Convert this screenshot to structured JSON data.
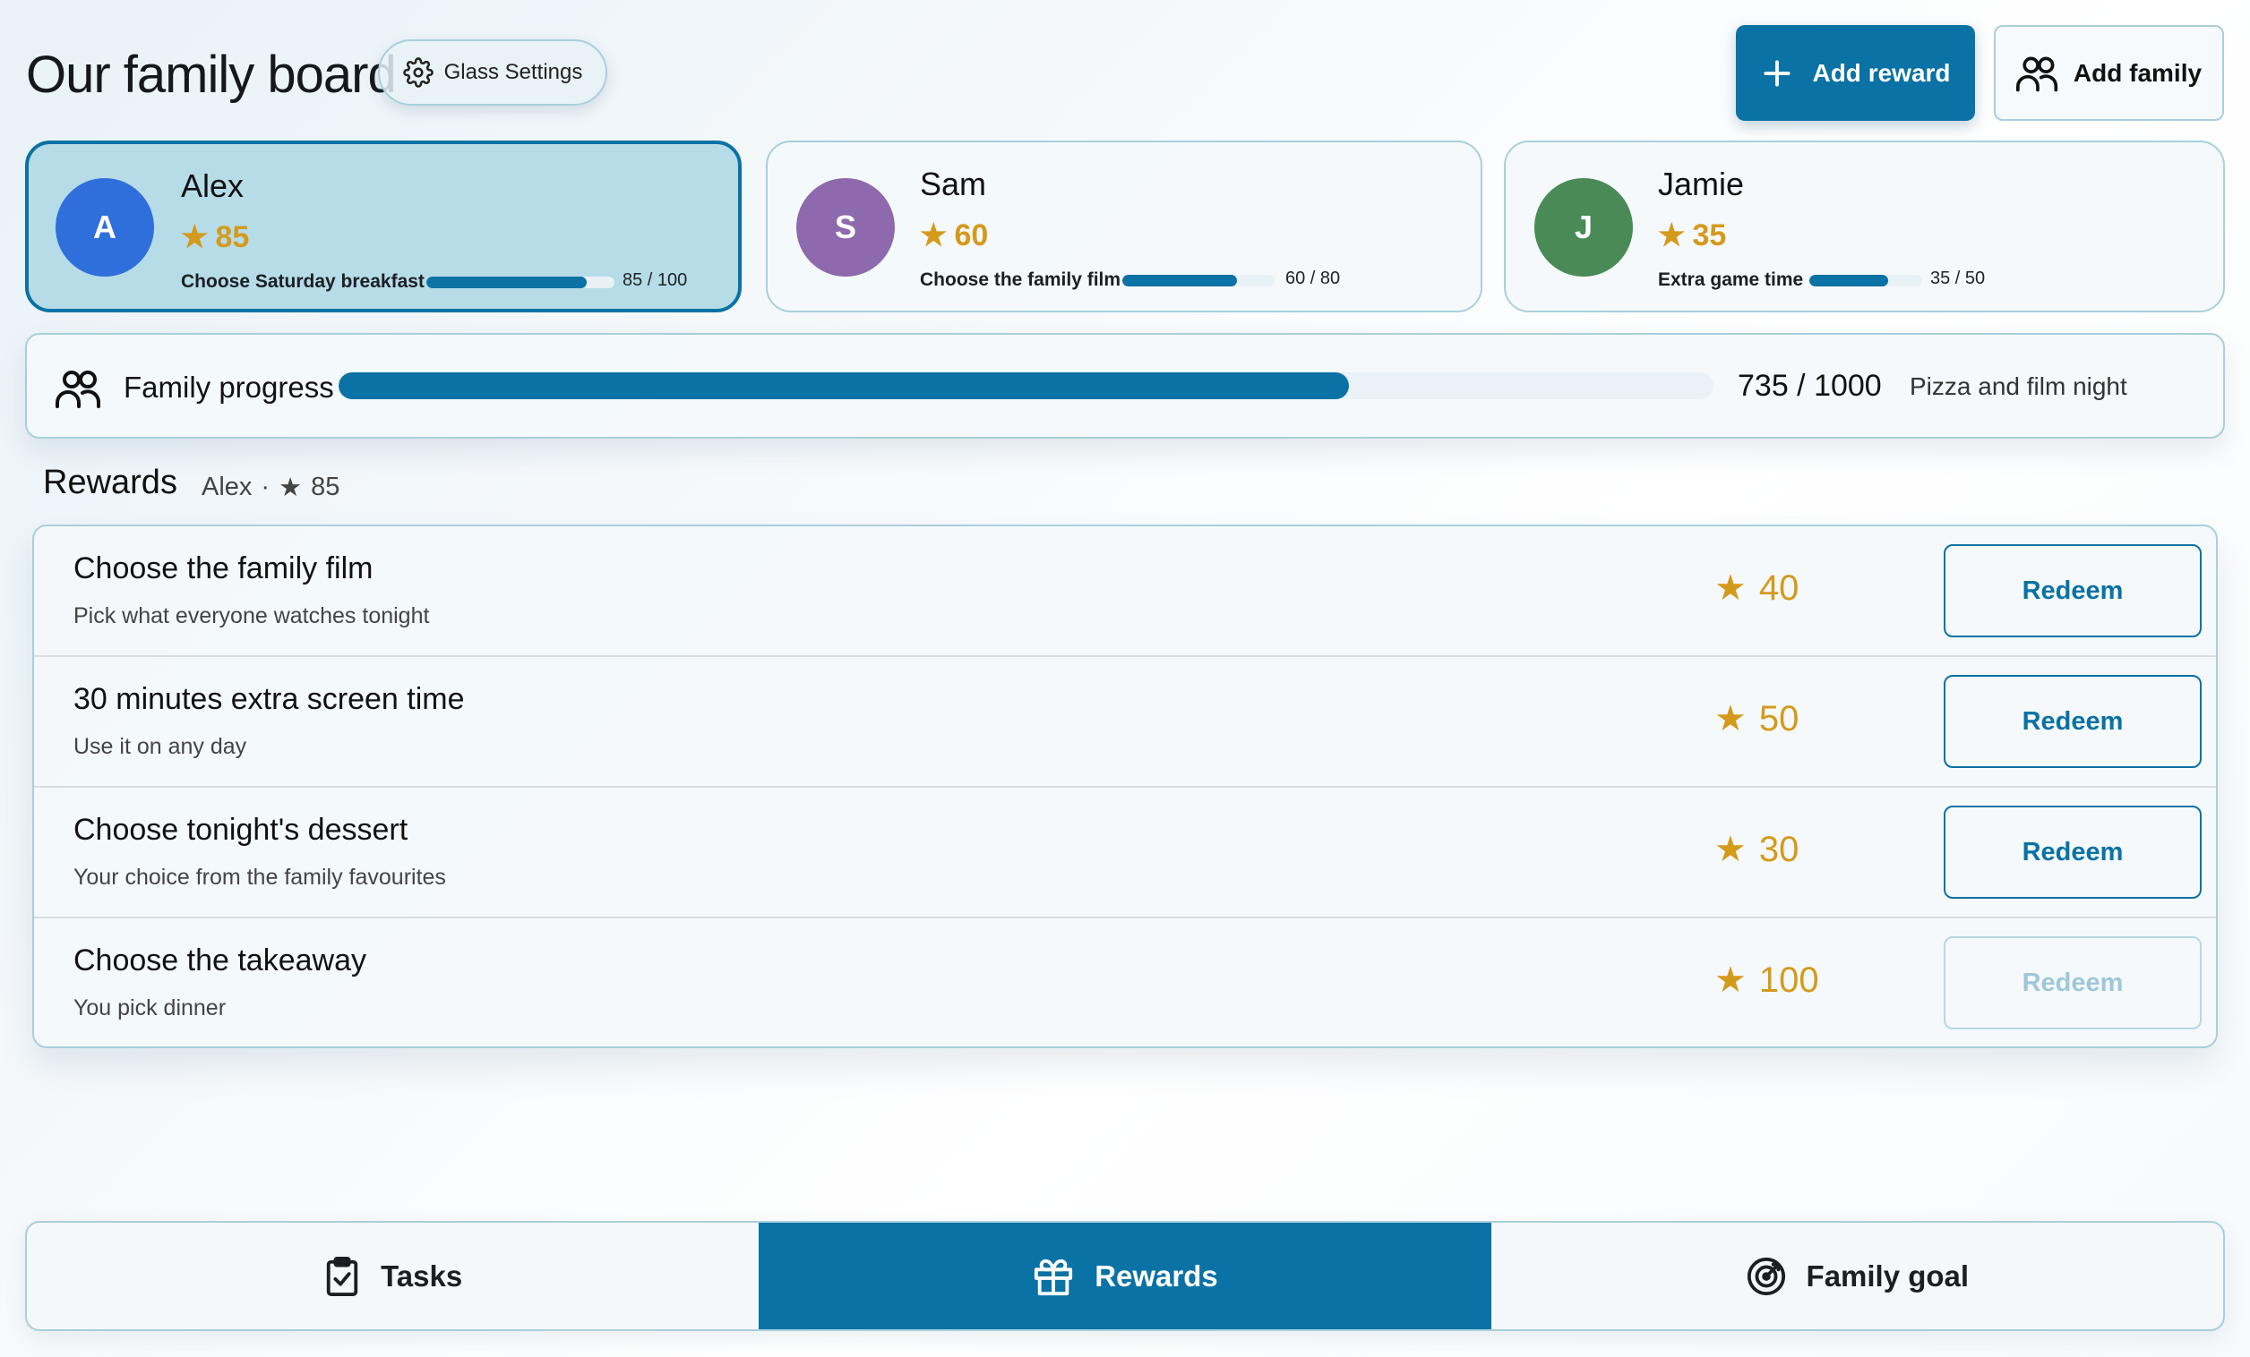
{
  "header": {
    "title": "Our family board",
    "glass_settings_label": "Glass Settings",
    "add_reward_label": "Add reward",
    "add_family_label": "Add family"
  },
  "members": [
    {
      "name": "Alex",
      "initial": "A",
      "stars": "85",
      "goal": "Choose Saturday breakfast",
      "progress": "85 / 100",
      "progress_fraction": 0.85,
      "color": "#2f6fdc",
      "selected": true
    },
    {
      "name": "Sam",
      "initial": "S",
      "stars": "60",
      "goal": "Choose the family film",
      "progress": "60 / 80",
      "progress_fraction": 0.75,
      "color": "#8e69ad",
      "selected": false
    },
    {
      "name": "Jamie",
      "initial": "J",
      "stars": "35",
      "goal": "Extra game time",
      "progress": "35 / 50",
      "progress_fraction": 0.7,
      "color": "#4a8a57",
      "selected": false
    }
  ],
  "family_progress": {
    "label": "Family progress",
    "count": "735 / 1000",
    "fraction": 0.735,
    "reward": "Pizza and film night"
  },
  "rewards": {
    "title": "Rewards",
    "member_name": "Alex",
    "separator": "·",
    "member_stars": "85",
    "items": [
      {
        "title": "Choose the family film",
        "description": "Pick what everyone watches tonight",
        "cost": "40",
        "redeem_label": "Redeem",
        "enabled": true
      },
      {
        "title": "30 minutes extra screen time",
        "description": "Use it on any day",
        "cost": "50",
        "redeem_label": "Redeem",
        "enabled": true
      },
      {
        "title": "Choose tonight's dessert",
        "description": "Your choice from the family favourites",
        "cost": "30",
        "redeem_label": "Redeem",
        "enabled": true
      },
      {
        "title": "Choose the takeaway",
        "description": "You pick dinner",
        "cost": "100",
        "redeem_label": "Redeem",
        "enabled": false
      }
    ]
  },
  "nav": {
    "tabs": [
      {
        "label": "Tasks",
        "icon": "clipboard-check-icon",
        "active": false
      },
      {
        "label": "Rewards",
        "icon": "gift-icon",
        "active": true
      },
      {
        "label": "Family goal",
        "icon": "target-icon",
        "active": false
      }
    ]
  },
  "colors": {
    "accent": "#0a72a4",
    "star": "#d49a1c",
    "selected_card_bg": "#b6dce8",
    "border": "#a9cfdc"
  },
  "icons": {
    "star": "★"
  }
}
